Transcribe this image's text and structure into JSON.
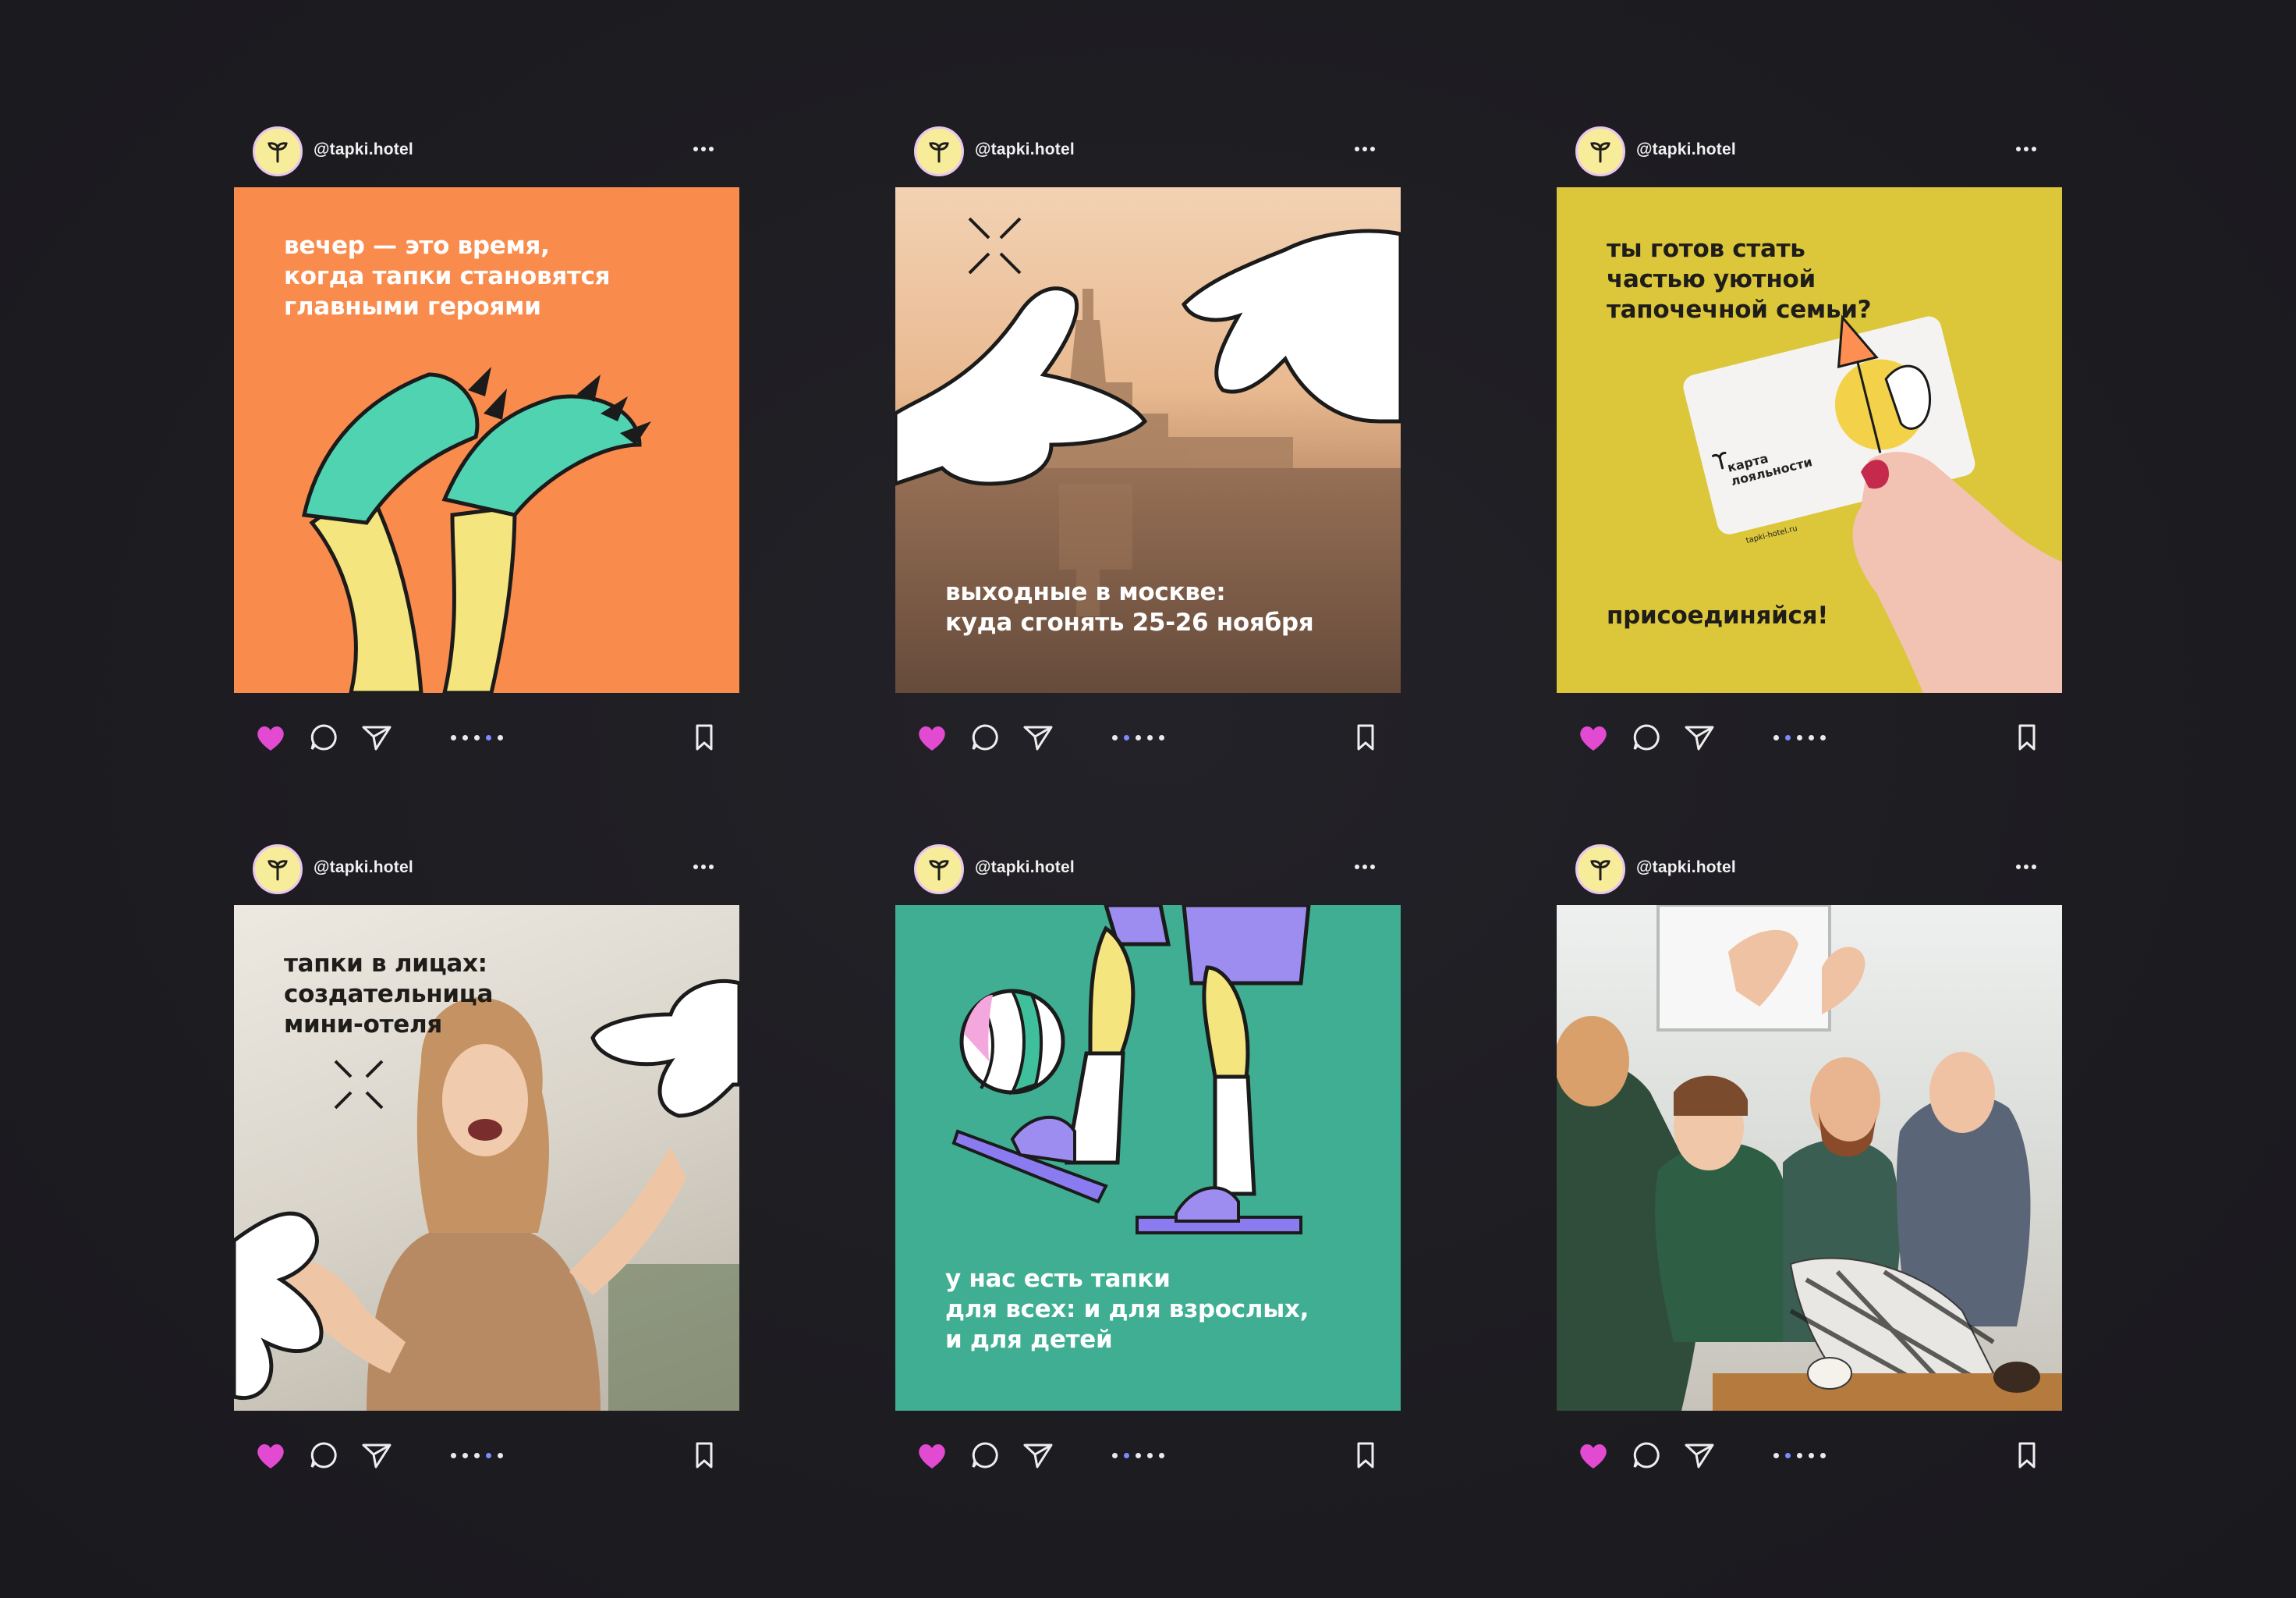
{
  "colors": {
    "background": "#1d1c21",
    "like": "#e24ad2",
    "active_dot": "#7c8bff",
    "orange": "#f98b4d",
    "yellow": "#dcc63a",
    "teal": "#3fae92"
  },
  "icons": {
    "like": "heart-icon",
    "comment": "comment-icon",
    "share": "send-icon",
    "save": "bookmark-icon",
    "more": "more-icon",
    "avatar": "sprout-logo"
  },
  "posts": [
    {
      "handle": "@tapki.hotel",
      "caption": "вечер — это время,\nкогда тапки становятся\nглавными героями",
      "dots_total": 5,
      "active_dot": 4
    },
    {
      "handle": "@tapki.hotel",
      "caption": "выходные в москве:\nкуда сгонять 25-26 ноября",
      "dots_total": 5,
      "active_dot": 2
    },
    {
      "handle": "@tapki.hotel",
      "caption": "ты готов стать\nчастью уютной\nтапочечной семьи?",
      "caption2": "присоединяйся!",
      "card": {
        "title": "карта\nлояльности",
        "url": "tapki-hotel.ru"
      },
      "dots_total": 5,
      "active_dot": 2
    },
    {
      "handle": "@tapki.hotel",
      "caption": "тапки в лицах:\nсоздательница\nмини-отеля",
      "dots_total": 5,
      "active_dot": 4
    },
    {
      "handle": "@tapki.hotel",
      "caption": "у нас есть тапки\nдля всех: и для взрослых,\nи для детей",
      "dots_total": 5,
      "active_dot": 2
    },
    {
      "handle": "@tapki.hotel",
      "dots_total": 5,
      "active_dot": 2
    }
  ]
}
